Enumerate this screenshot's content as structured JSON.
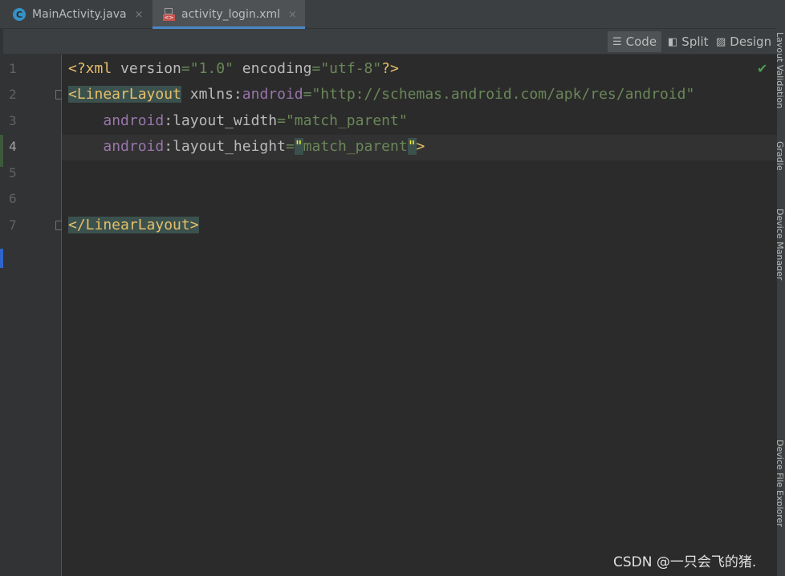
{
  "tabs": [
    {
      "label": "MainActivity.java",
      "icon": "c-icon",
      "close": "×"
    },
    {
      "label": "activity_login.xml",
      "icon": "xml-file-icon",
      "close": "×"
    }
  ],
  "toolbar": {
    "code_label": "Code",
    "split_label": "Split",
    "design_label": "Design"
  },
  "gutter": {
    "line_numbers": [
      "1",
      "2",
      "3",
      "4",
      "5",
      "6",
      "7"
    ],
    "current_line": "4"
  },
  "code": {
    "l1_open": "<?xml ",
    "l1_attr1": "version",
    "l1_eq1": "=",
    "l1_val1": "\"1.0\"",
    "l1_attr2": " encoding",
    "l1_eq2": "=",
    "l1_val2": "\"utf-8\"",
    "l1_close": "?>",
    "l2_tag": "<LinearLayout",
    "l2_attr": " xmlns",
    "l2_colon": ":",
    "l2_ns": "android",
    "l2_eq": "=",
    "l2_val": "\"http://schemas.android.com/apk/res/android\"",
    "l3_indent": "    ",
    "l3_ns": "android",
    "l3_colon": ":",
    "l3_attr": "layout_width",
    "l3_eq": "=",
    "l3_val": "\"match_parent\"",
    "l4_indent": "    ",
    "l4_ns": "android",
    "l4_colon": ":",
    "l4_attr": "layout_height",
    "l4_eq": "=",
    "l4_q1": "\"",
    "l4_val": "match_parent",
    "l4_q2": "\"",
    "l4_close": ">",
    "l7_tag": "</LinearLayout>"
  },
  "status": {
    "check": "✔"
  },
  "right_tools": [
    "Layout Validation",
    "Gradle",
    "Device Manager",
    "Device File Explorer"
  ],
  "watermark": "CSDN @一只会飞的猪."
}
